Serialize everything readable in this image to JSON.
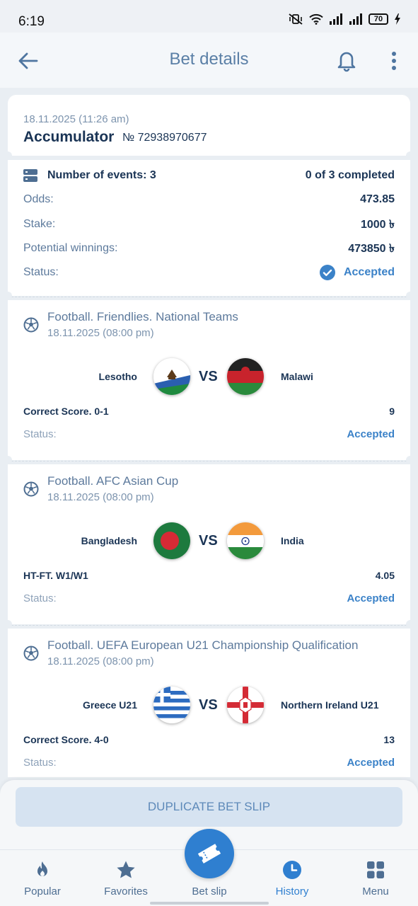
{
  "status_bar": {
    "time": "6:19",
    "battery": "70"
  },
  "header": {
    "title": "Bet details",
    "back_icon": "arrow-left-icon",
    "bell_icon": "bell-icon",
    "more_icon": "more-vertical-icon"
  },
  "bet": {
    "date": "18.11.2025 (11:26 am)",
    "type": "Accumulator",
    "number": "№ 72938970677",
    "events_label": "Number of events: 3",
    "completed": "0 of 3 completed",
    "odds_label": "Odds:",
    "odds": "473.85",
    "stake_label": "Stake:",
    "stake": "1000 ৳",
    "winnings_label": "Potential winnings:",
    "winnings": "473850 ৳",
    "status_label": "Status:",
    "status": "Accepted"
  },
  "events": [
    {
      "name": "Football. Friendlies. National Teams",
      "date": "18.11.2025 (08:00 pm)",
      "team1": "Lesotho",
      "team2": "Malawi",
      "vs": "VS",
      "market": "Correct Score. 0-1",
      "coef": "9",
      "status_label": "Status:",
      "status": "Accepted"
    },
    {
      "name": "Football. AFC Asian Cup",
      "date": "18.11.2025 (08:00 pm)",
      "team1": "Bangladesh",
      "team2": "India",
      "vs": "VS",
      "market": "HT-FT. W1/W1",
      "coef": "4.05",
      "status_label": "Status:",
      "status": "Accepted"
    },
    {
      "name": "Football. UEFA European U21 Championship Qualification",
      "date": "18.11.2025 (08:00 pm)",
      "team1": "Greece U21",
      "team2": "Northern Ireland U21",
      "vs": "VS",
      "market": "Correct Score. 4-0",
      "coef": "13",
      "status_label": "Status:",
      "status": "Accepted"
    }
  ],
  "actions": {
    "duplicate": "DUPLICATE BET SLIP"
  },
  "nav": {
    "popular": "Popular",
    "favorites": "Favorites",
    "betslip": "Bet slip",
    "history": "History",
    "menu": "Menu"
  },
  "colors": {
    "accent": "#2f7fd0",
    "primary_text": "#1a3455",
    "secondary_text": "#5d7a9c",
    "background": "#e9eef3"
  }
}
